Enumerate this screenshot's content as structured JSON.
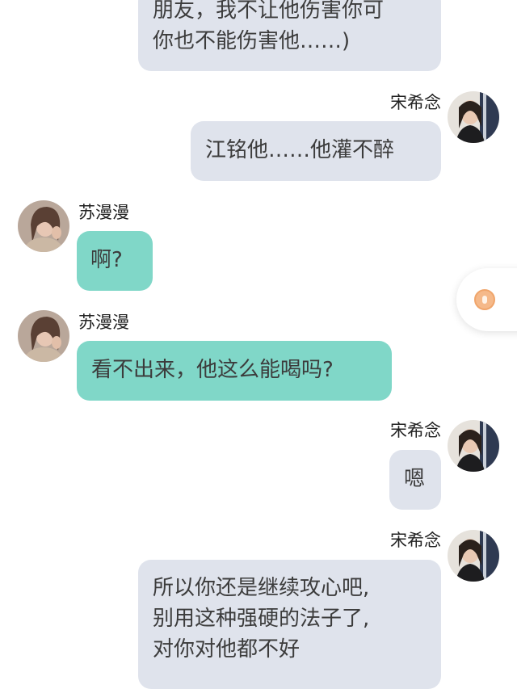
{
  "colors": {
    "outgoing_bubble": "#dfe3ec",
    "incoming_bubble": "#80d7c8",
    "background": "#ffffff",
    "float_coin": "#f5b98a"
  },
  "floating_button": {
    "icon": "coin-icon"
  },
  "messages": [
    {
      "side": "right",
      "sender": "",
      "text": "朋友，我不让他伤害你可\n你也不能伤害他……)",
      "avatar": ""
    },
    {
      "side": "right",
      "sender": "宋希念",
      "text": "江铭他……他灌不醉",
      "avatar": "avatar-song-xinian"
    },
    {
      "side": "left",
      "sender": "苏漫漫",
      "text": "啊?",
      "avatar": "avatar-su-manman"
    },
    {
      "side": "left",
      "sender": "苏漫漫",
      "text": "看不出来，他这么能喝吗?",
      "avatar": "avatar-su-manman"
    },
    {
      "side": "right",
      "sender": "宋希念",
      "text": "嗯",
      "avatar": "avatar-song-xinian"
    },
    {
      "side": "right",
      "sender": "宋希念",
      "text": "所以你还是继续攻心吧,\n别用这种强硬的法子了,\n对你对他都不好",
      "avatar": "avatar-song-xinian"
    }
  ]
}
